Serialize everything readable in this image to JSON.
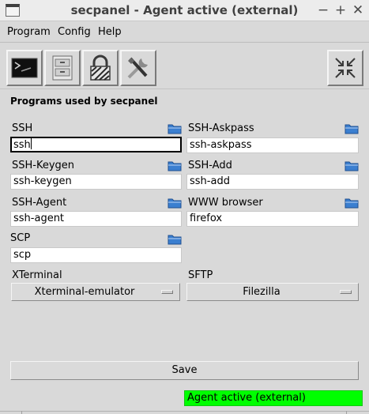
{
  "window": {
    "title": "secpanel - Agent active (external)"
  },
  "window_buttons": {
    "minimize": "−",
    "maximize": "+",
    "close": "✕"
  },
  "menu": [
    "Program",
    "Config",
    "Help"
  ],
  "toolbar": {
    "icons": [
      "terminal-icon",
      "file-cabinet-icon",
      "padlock-icon",
      "tools-icon"
    ],
    "right_icon": "compress-icon"
  },
  "section_title": "Programs used by secpanel",
  "fields": {
    "ssh": {
      "label": "SSH",
      "value": "ssh"
    },
    "ssh_askpass": {
      "label": "SSH-Askpass",
      "value": "ssh-askpass"
    },
    "ssh_keygen": {
      "label": "SSH-Keygen",
      "value": "ssh-keygen"
    },
    "ssh_add": {
      "label": "SSH-Add",
      "value": "ssh-add"
    },
    "ssh_agent": {
      "label": "SSH-Agent",
      "value": "ssh-agent"
    },
    "www_browser": {
      "label": "WWW browser",
      "value": "firefox"
    },
    "scp": {
      "label": "SCP",
      "value": "scp"
    }
  },
  "selects": {
    "xterminal": {
      "label": "XTerminal",
      "value": "Xterminal-emulator"
    },
    "sftp": {
      "label": "SFTP",
      "value": "Filezilla"
    }
  },
  "save_label": "Save",
  "status": {
    "text": "Agent active (external)",
    "color": "#00ff00"
  },
  "colors": {
    "background": "#d9d9d9",
    "folder_icon": "#3b7fd0"
  }
}
